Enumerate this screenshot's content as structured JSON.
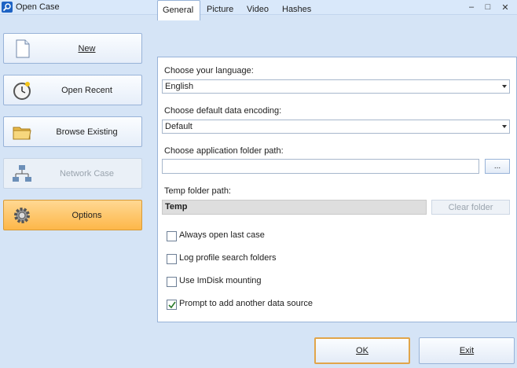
{
  "window": {
    "title": "Open Case",
    "controls": {
      "minimize": "–",
      "maximize": "□",
      "close": "✕"
    }
  },
  "sidebar": {
    "items": [
      {
        "label": "New",
        "icon": "document-icon",
        "state": "normal"
      },
      {
        "label": "Open Recent",
        "icon": "clock-icon",
        "state": "normal"
      },
      {
        "label": "Browse Existing",
        "icon": "folder-icon",
        "state": "normal"
      },
      {
        "label": "Network Case",
        "icon": "network-icon",
        "state": "disabled"
      },
      {
        "label": "Options",
        "icon": "gear-icon",
        "state": "selected"
      }
    ]
  },
  "tabs": [
    {
      "label": "General",
      "active": true
    },
    {
      "label": "Picture",
      "active": false
    },
    {
      "label": "Video",
      "active": false
    },
    {
      "label": "Hashes",
      "active": false
    }
  ],
  "general": {
    "language_label": "Choose your language:",
    "language_value": "English",
    "encoding_label": "Choose default data encoding:",
    "encoding_value": "Default",
    "app_folder_label": "Choose application folder path:",
    "app_folder_value": "",
    "browse_label": "...",
    "temp_folder_label": "Temp folder path:",
    "temp_folder_value": "Temp",
    "clear_folder_label": "Clear folder",
    "options": [
      {
        "label": "Always open last case",
        "checked": false
      },
      {
        "label": "Log profile search folders",
        "checked": false
      },
      {
        "label": "Use ImDisk mounting",
        "checked": false
      },
      {
        "label": "Prompt to add another data source",
        "checked": true
      }
    ]
  },
  "footer": {
    "ok_label": "OK",
    "exit_label": "Exit"
  },
  "colors": {
    "background": "#d5e4f6",
    "selected_button": "#fdb749",
    "panel_border": "#98b3d8"
  }
}
